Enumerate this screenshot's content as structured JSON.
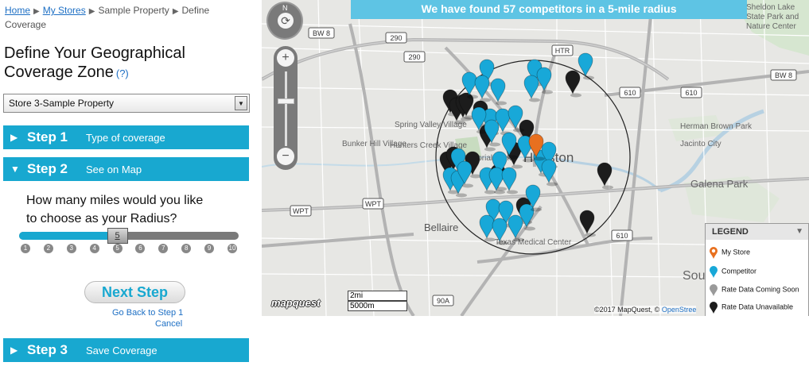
{
  "breadcrumb": {
    "home": "Home",
    "my_stores": "My Stores",
    "property": "Sample Property",
    "current_line1": "Define",
    "current_line2": "Coverage"
  },
  "title": {
    "line1": "Define Your Geographical",
    "line2": "Coverage Zone",
    "help": "(?)"
  },
  "store_select": {
    "value": "Store 3-Sample Property"
  },
  "steps": [
    {
      "num": "Step 1",
      "desc": "Type of coverage",
      "state": "collapsed"
    },
    {
      "num": "Step 2",
      "desc": "See on Map",
      "state": "expanded"
    },
    {
      "num": "Step 3",
      "desc": "Save Coverage",
      "state": "collapsed"
    }
  ],
  "radius_question": {
    "line1": "How many miles would you like",
    "line2": "to choose as your Radius?"
  },
  "slider": {
    "value": 5,
    "min": 1,
    "max": 10,
    "handle_label": "5",
    "ticks": [
      "1",
      "2",
      "3",
      "4",
      "5",
      "6",
      "7",
      "8",
      "9",
      "10"
    ]
  },
  "buttons": {
    "next": "Next Step",
    "go_back": "Go Back to Step 1",
    "cancel": "Cancel"
  },
  "map": {
    "banner": "We have found 57 competitors in a 5-mile radius",
    "compass": "N",
    "zoom_in": "+",
    "zoom_out": "−",
    "scale_miles": "2mi",
    "scale_meters": "5000m",
    "logo": "mapquest",
    "copyright": "©2017 MapQuest, ©",
    "copyright_link": "OpenStree",
    "labels": {
      "sheldon": "Sheldon Lake",
      "state_park": "State Park and",
      "nature_center": "Nature Center",
      "spring_valley": "Spring Valley Village",
      "hunters_creek": "Hunters Creek Village",
      "bunker_hill": "Bunker Hill Village",
      "memorial_park": "Memorial Park",
      "houston": "Houston",
      "bellaire": "Bellaire",
      "texas_medical": "Texas Medical Center",
      "herman_brown": "Herman Brown Park",
      "jacinto": "Jacinto City",
      "galena": "Galena Park",
      "south": "South"
    },
    "shields": [
      "BW 8",
      "290",
      "290",
      "HTR",
      "BW 8",
      "610",
      "WPT",
      "WPT",
      "610",
      "90A",
      "610"
    ]
  },
  "legend": {
    "title": "LEGEND",
    "items": [
      {
        "label": "My Store",
        "color": "#e8701f",
        "hollow": true
      },
      {
        "label": "Competitor",
        "color": "#18a8d8",
        "hollow": false
      },
      {
        "label": "Rate Data Coming Soon",
        "color": "#9a9a9a",
        "hollow": false
      },
      {
        "label": "Rate Data Unavailable",
        "color": "#1c1c1c",
        "hollow": false
      }
    ]
  },
  "colors": {
    "accent": "#18a8d0",
    "competitor": "#18a8d8",
    "unavailable": "#1c1c1c",
    "my_store": "#e8701f"
  },
  "markers": {
    "my_store": [
      [
        674,
        198
      ]
    ],
    "competitor": [
      [
        736,
        96
      ],
      [
        612,
        104
      ],
      [
        590,
        120
      ],
      [
        606,
        124
      ],
      [
        626,
        128
      ],
      [
        672,
        104
      ],
      [
        684,
        114
      ],
      [
        668,
        124
      ],
      [
        616,
        166
      ],
      [
        632,
        166
      ],
      [
        648,
        162
      ],
      [
        640,
        196
      ],
      [
        660,
        200
      ],
      [
        628,
        220
      ],
      [
        612,
        240
      ],
      [
        624,
        240
      ],
      [
        640,
        240
      ],
      [
        680,
        218
      ],
      [
        690,
        208
      ],
      [
        576,
        216
      ],
      [
        566,
        240
      ],
      [
        576,
        244
      ],
      [
        584,
        232
      ],
      [
        620,
        280
      ],
      [
        636,
        282
      ],
      [
        612,
        300
      ],
      [
        628,
        304
      ],
      [
        648,
        300
      ],
      [
        662,
        286
      ],
      [
        670,
        262
      ],
      [
        690,
        230
      ],
      [
        602,
        164
      ],
      [
        618,
        180
      ]
    ],
    "unavailable": [
      [
        566,
        142
      ],
      [
        574,
        152
      ],
      [
        582,
        148
      ],
      [
        586,
        146
      ],
      [
        604,
        156
      ],
      [
        612,
        186
      ],
      [
        662,
        180
      ],
      [
        646,
        208
      ],
      [
        626,
        236
      ],
      [
        562,
        220
      ],
      [
        570,
        214
      ],
      [
        594,
        220
      ],
      [
        658,
        278
      ],
      [
        720,
        118
      ],
      [
        760,
        234
      ],
      [
        738,
        294
      ]
    ]
  }
}
